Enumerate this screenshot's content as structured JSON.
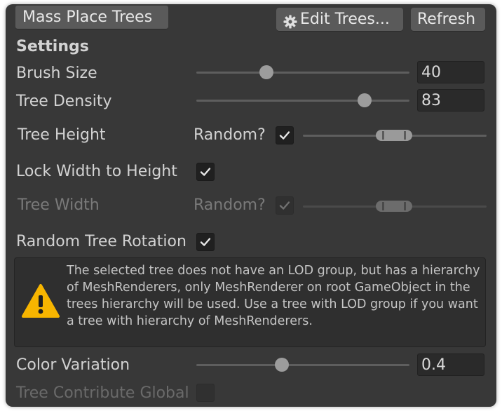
{
  "toolbar": {
    "mass_place": "Mass Place Trees",
    "edit_trees": "Edit Trees...",
    "refresh": "Refresh",
    "edit_icon": "gear-icon"
  },
  "settings": {
    "header": "Settings",
    "brush_size": {
      "label": "Brush Size",
      "value": "40",
      "slider_fraction": 0.33
    },
    "tree_density": {
      "label": "Tree Density",
      "value": "83",
      "slider_fraction": 0.79
    },
    "tree_height": {
      "label": "Tree Height",
      "random_label": "Random?",
      "random_checked": true
    },
    "lock_width": {
      "label": "Lock Width to Height",
      "checked": true
    },
    "tree_width": {
      "label": "Tree Width",
      "random_label": "Random?",
      "random_checked": true,
      "disabled": true
    },
    "random_rotation": {
      "label": "Random Tree Rotation",
      "checked": true
    },
    "warning": {
      "icon": "warning-icon",
      "text": "The selected tree does not have an LOD group, but has a hierarchy of MeshRenderers, only MeshRenderer on root GameObject in the trees hierarchy will be used. Use a tree with LOD group if you want a tree with hierarchy of MeshRenderers."
    },
    "color_variation": {
      "label": "Color Variation",
      "value": "0.4",
      "slider_fraction": 0.4
    },
    "contribute_gi": {
      "label": "Tree Contribute Global",
      "checked": false,
      "disabled": true
    }
  },
  "colors": {
    "panel_bg": "#383838",
    "warning_yellow": "#f7b500",
    "disabled_text": "#7a7a7a"
  }
}
